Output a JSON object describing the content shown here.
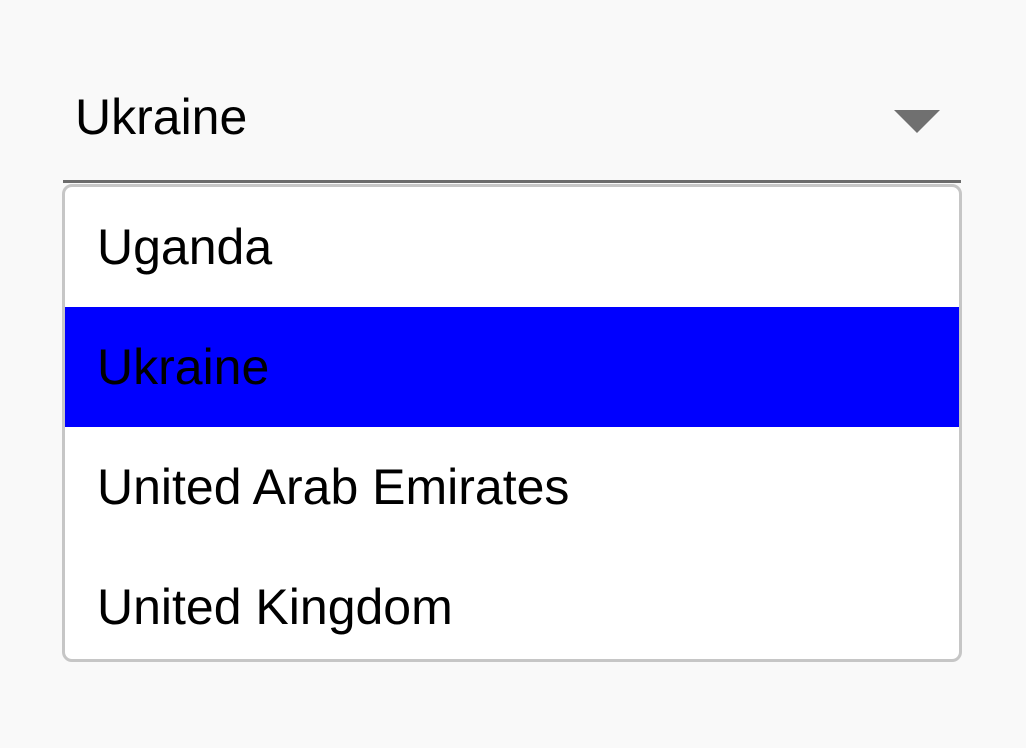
{
  "select": {
    "value": "Ukraine",
    "arrow_icon": "triangle-down-icon"
  },
  "dropdown": {
    "options": [
      {
        "label": "Uganda",
        "selected": false
      },
      {
        "label": "Ukraine",
        "selected": true
      },
      {
        "label": "United Arab Emirates",
        "selected": false
      },
      {
        "label": "United Kingdom",
        "selected": false
      }
    ]
  },
  "colors": {
    "background": "#f9f9f9",
    "selected_option": "#0000ff",
    "underline": "#6b6b6b",
    "arrow": "#707070",
    "dropdown_border": "#c6c6c6"
  }
}
